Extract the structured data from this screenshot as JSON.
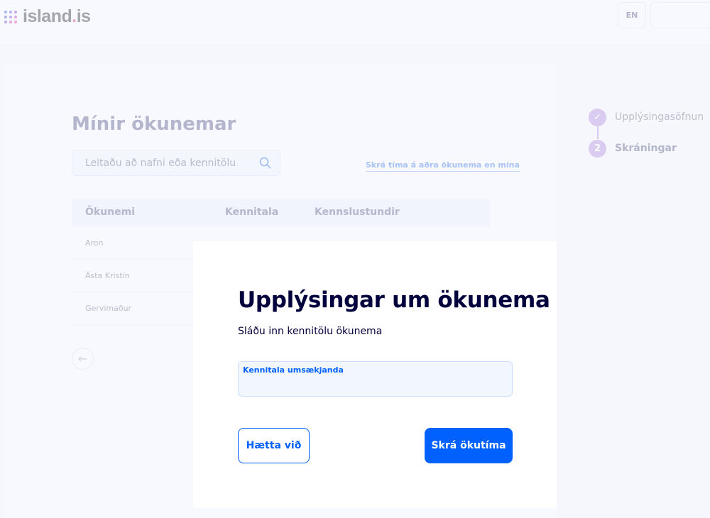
{
  "header": {
    "logo_text": "island",
    "logo_dot": ".",
    "logo_suffix": "is",
    "language_button": "EN"
  },
  "page": {
    "title": "Mínir ökunemar",
    "search_placeholder": "Leitaðu að nafni eða kennitölu",
    "other_students_link": "Skrá tíma á aðra ökunema en mína"
  },
  "table": {
    "headers": [
      "Ökunemi",
      "Kennitala",
      "Kennslustundir"
    ],
    "rows": [
      {
        "name": "Aron"
      },
      {
        "name": "Ásta Kristín"
      },
      {
        "name": "Gervimaður"
      }
    ]
  },
  "steps": [
    {
      "label": "Upplýsingasöfnun",
      "status": "done",
      "marker": "✓"
    },
    {
      "label": "Skráningar",
      "status": "current",
      "marker": "2"
    }
  ],
  "modal": {
    "title": "Upplýsingar um ökunema",
    "subtitle": "Sláðu inn kennitölu ökunema",
    "field_label": "Kennitala umsækjanda",
    "field_value": "",
    "cancel_label": "Hætta við",
    "submit_label": "Skrá ökutíma"
  }
}
